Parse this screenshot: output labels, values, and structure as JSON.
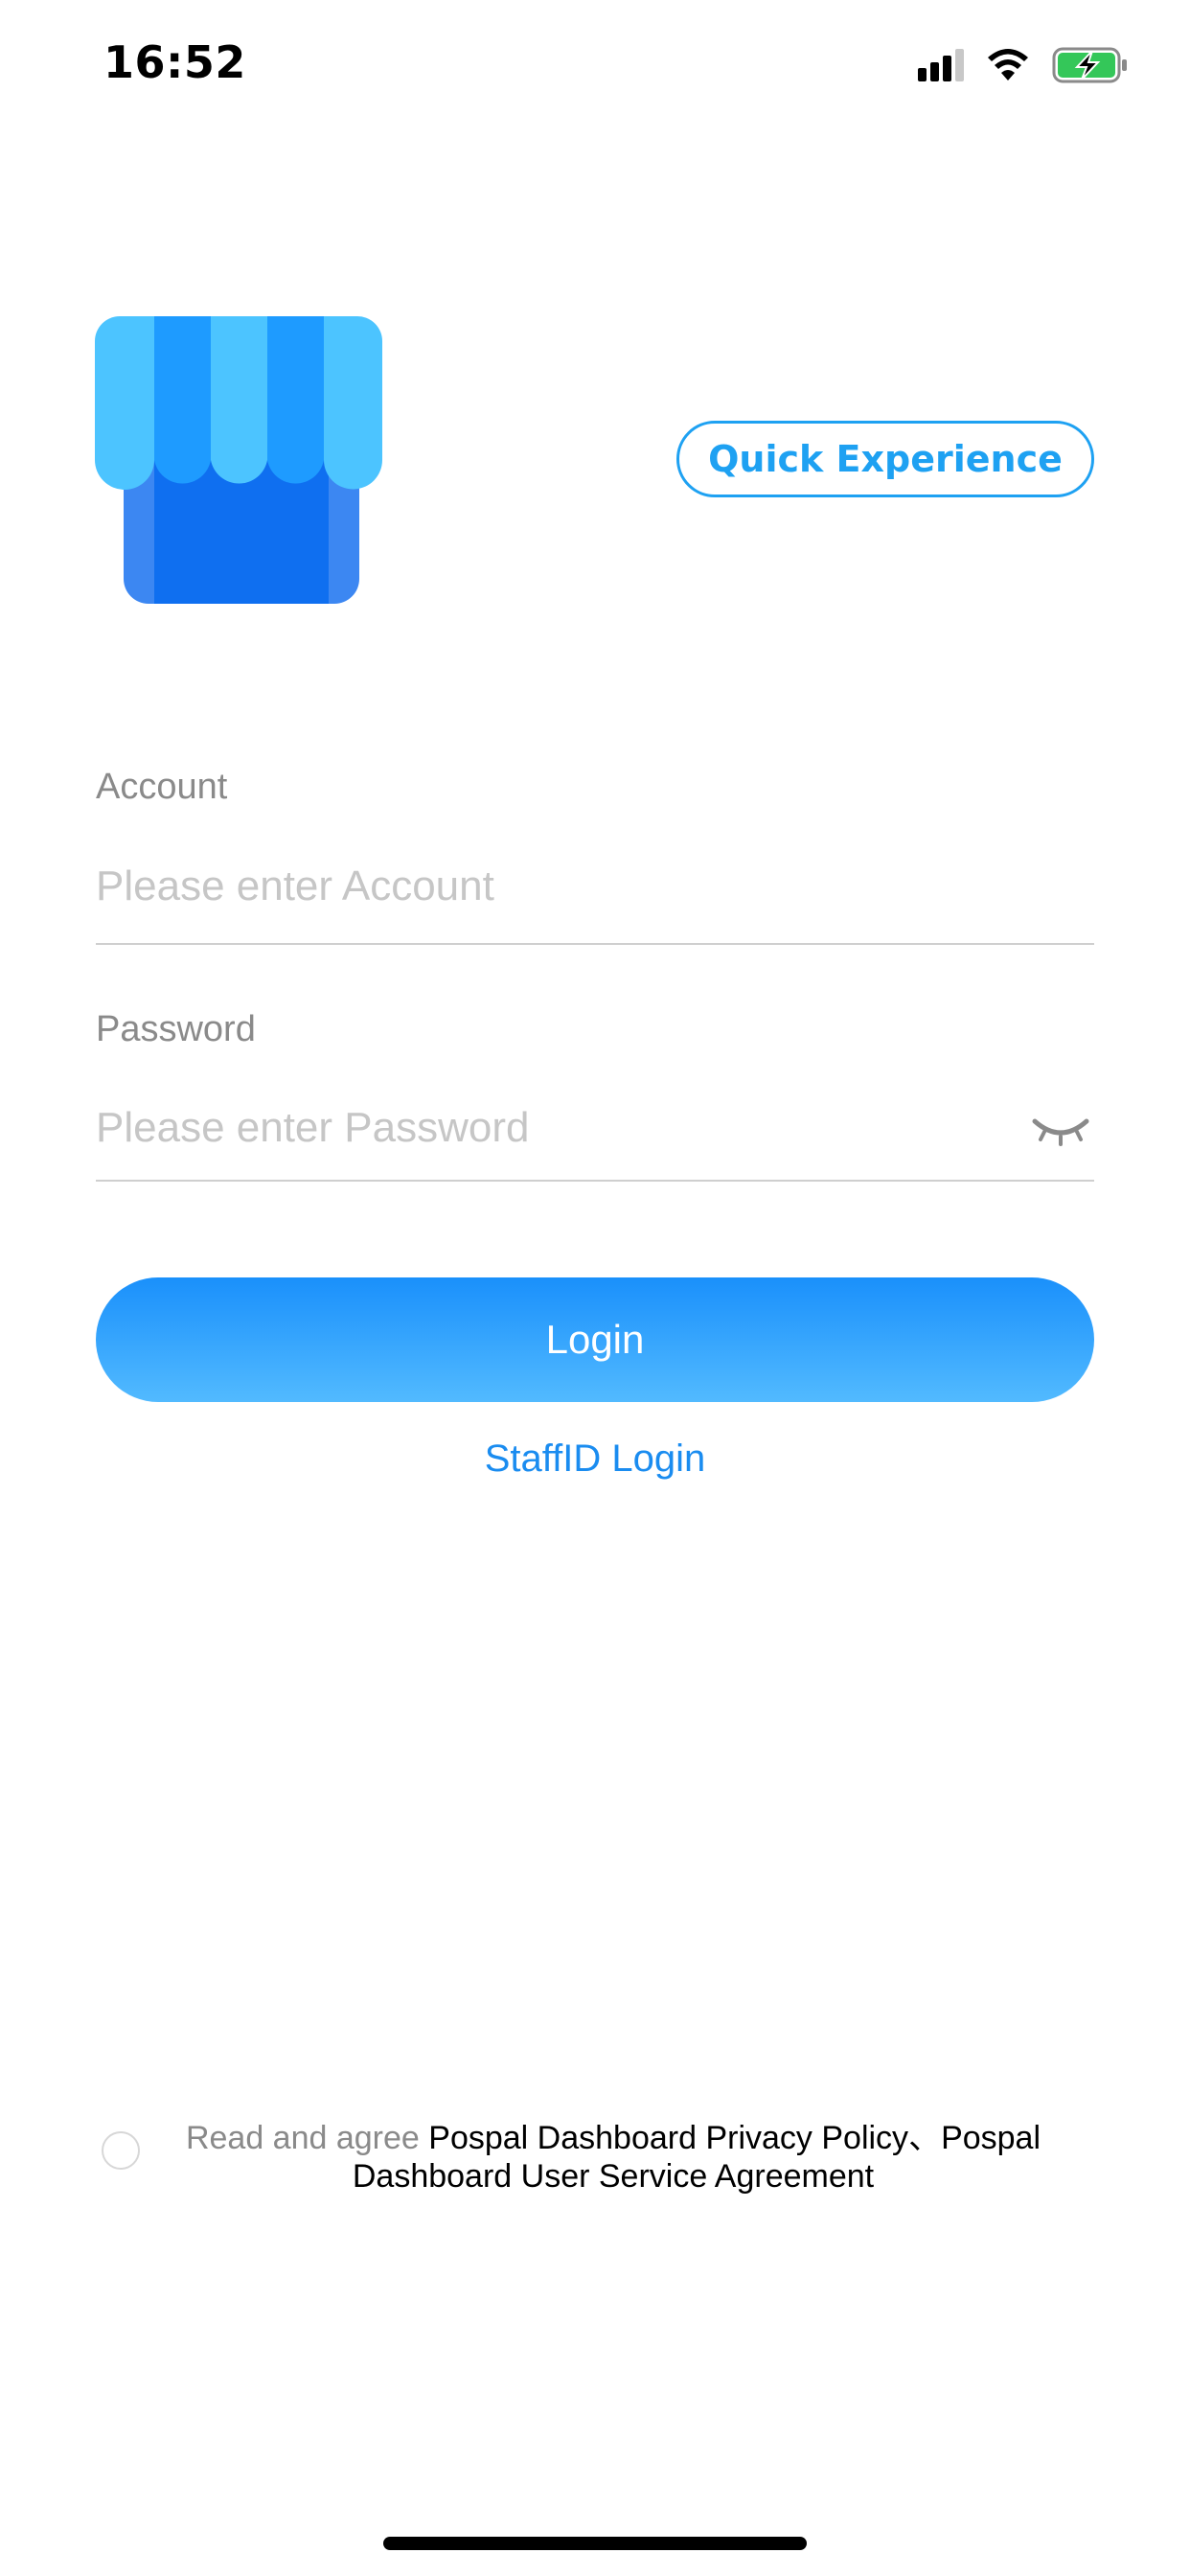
{
  "status_bar": {
    "time": "16:52",
    "icons": [
      "signal-icon",
      "wifi-icon",
      "battery-charging-icon"
    ]
  },
  "header": {
    "logo": "store-awning-logo",
    "quick_experience_label": "Quick Experience"
  },
  "form": {
    "account": {
      "label": "Account",
      "placeholder": "Please enter Account",
      "value": ""
    },
    "password": {
      "label": "Password",
      "placeholder": "Please enter Password",
      "value": "",
      "toggle_icon": "eye-closed-icon"
    },
    "login_label": "Login",
    "staff_login_label": "StaffID Login"
  },
  "agreement": {
    "checked": false,
    "prefix": "Read and agree ",
    "privacy_policy": "Pospal Dashboard Privacy Policy",
    "separator": "、",
    "service_agreement": "Pospal Dashboard User Service Agreement"
  },
  "colors": {
    "accent": "#1ea1f2",
    "login_gradient_top": "#1a90fb",
    "login_gradient_bottom": "#52baff",
    "link": "#1a8cf0"
  }
}
